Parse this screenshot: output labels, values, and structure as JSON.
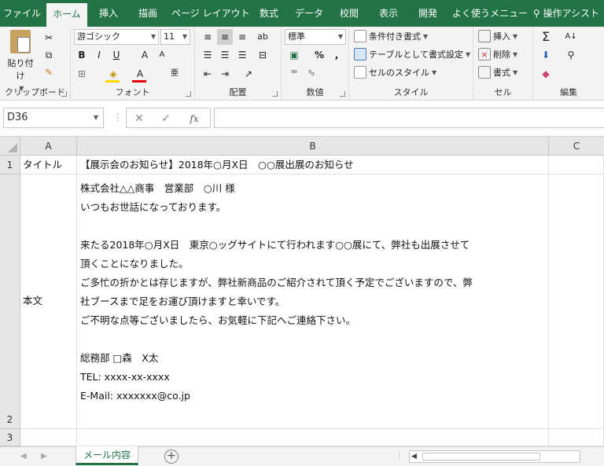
{
  "tabs": [
    "ファイル",
    "ホーム",
    "挿入",
    "描画",
    "ページ レイアウト",
    "数式",
    "データ",
    "校閲",
    "表示",
    "開発",
    "よく使うメニュー"
  ],
  "assist": "操作アシスト",
  "ribbon": {
    "clipboard": {
      "paste": "貼り付け",
      "label": "クリップボード"
    },
    "font": {
      "name": "游ゴシック",
      "size": "11",
      "bold": "B",
      "italic": "I",
      "underline": "U",
      "grow": "A",
      "shrink": "A",
      "color_letter": "A",
      "phonetic": "亜",
      "label": "フォント"
    },
    "align": {
      "label": "配置"
    },
    "number": {
      "format": "標準",
      "percent": "%",
      "comma": ",",
      "label": "数値"
    },
    "styles": {
      "conditional": "条件付き書式",
      "table": "テーブルとして書式設定",
      "cell": "セルのスタイル",
      "label": "スタイル"
    },
    "cells": {
      "insert": "挿入",
      "delete": "削除",
      "format": "書式",
      "label": "セル"
    },
    "editing": {
      "label": "編集"
    }
  },
  "formula_bar": {
    "name_box": "D36",
    "value": ""
  },
  "columns": [
    "A",
    "B",
    "C"
  ],
  "rows": [
    "1",
    "2",
    "3"
  ],
  "cells": {
    "A1": "タイトル",
    "B1": "【展示会のお知らせ】2018年○月X日　○○展出展のお知らせ",
    "A2": "本文",
    "B2_lines": [
      "株式会社△△商事　営業部　○川 様",
      "いつもお世話になっております。",
      "",
      "来たる2018年○月X日　東京○ッグサイトにて行われます○○展にて、弊社も出展させて",
      "頂くことになりました。",
      "ご多忙の折かとは存じますが、弊社新商品のご紹介されて頂く予定でございますので、弊",
      "社ブースまで足をお運び頂けますと幸いです。",
      "ご不明な点等ございましたら、お気軽に下記へご連絡下さい。",
      "",
      "総務部 □森　X太",
      "TEL: xxxx-xx-xxxx",
      "E-Mail: xxxxxxx@co.jp"
    ]
  },
  "sheet_tabs": [
    "メール内容"
  ],
  "colors": {
    "accent": "#217346"
  }
}
